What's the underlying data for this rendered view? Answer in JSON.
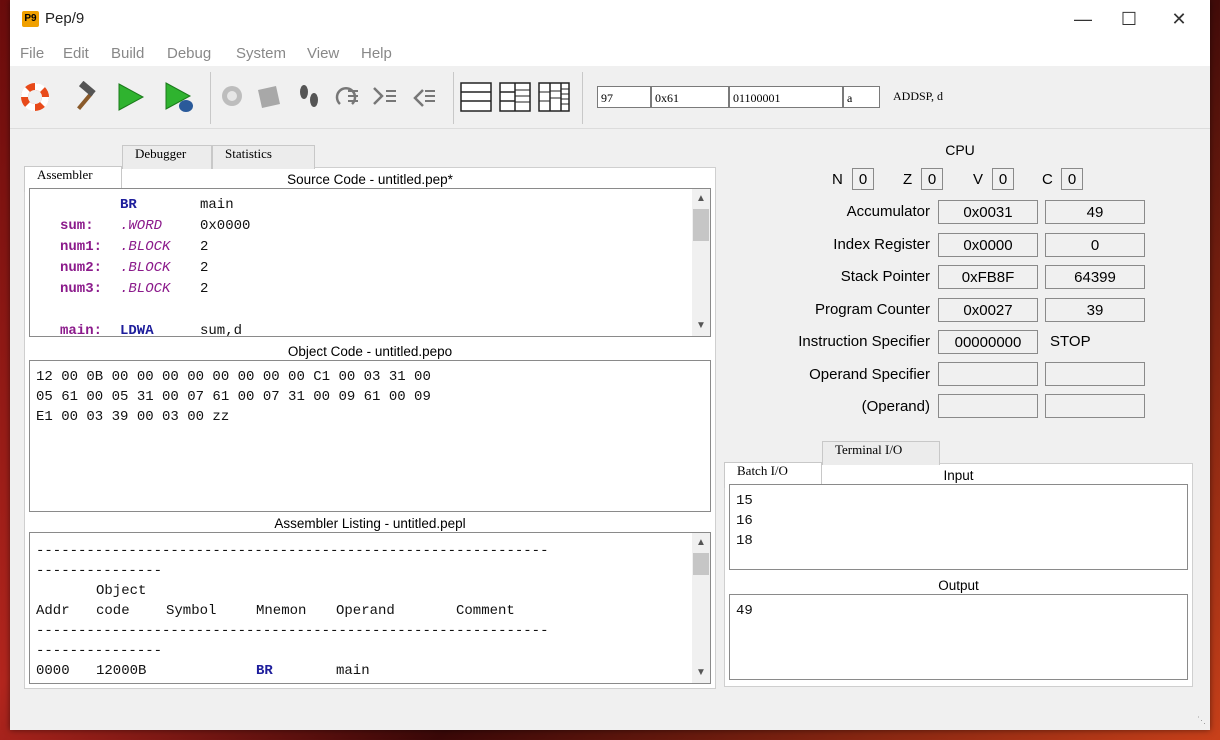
{
  "window": {
    "title": "Pep/9",
    "icon_text": "P9"
  },
  "menu": [
    "File",
    "Edit",
    "Build",
    "Debug",
    "System",
    "View",
    "Help"
  ],
  "toolbar": {
    "decimal": "97",
    "hex": "0x61",
    "binary": "01100001",
    "char": "a",
    "instruction": "ADDSP, d"
  },
  "left_tabs": [
    "Assembler",
    "Debugger",
    "Statistics"
  ],
  "source": {
    "title": "Source Code - untitled.pep*",
    "lines": [
      {
        "sym": "",
        "mn": "BR",
        "dir": "",
        "op": "main"
      },
      {
        "sym": "sum:",
        "mn": "",
        "dir": ".WORD",
        "op": "0x0000"
      },
      {
        "sym": "num1:",
        "mn": "",
        "dir": ".BLOCK",
        "op": "2"
      },
      {
        "sym": "num2:",
        "mn": "",
        "dir": ".BLOCK",
        "op": "2"
      },
      {
        "sym": "num3:",
        "mn": "",
        "dir": ".BLOCK",
        "op": "2"
      },
      {
        "sym": "",
        "mn": "",
        "dir": "",
        "op": ""
      },
      {
        "sym": "main:",
        "mn": "LDWA",
        "dir": "",
        "op": "sum,d"
      }
    ]
  },
  "object": {
    "title": "Object Code - untitled.pepo",
    "lines": [
      "12 00 0B 00 00 00 00 00 00 00 00 C1 00 03 31 00",
      "05 61 00 05 31 00 07 61 00 07 31 00 09 61 00 09",
      "E1 00 03 39 00 03 00 zz"
    ]
  },
  "listing": {
    "title": "Assembler Listing - untitled.pepl",
    "dash_long": "-------------------------------------------------------------",
    "dash_short": "---------------",
    "header_top": "Object",
    "headers": [
      "Addr",
      "code",
      "Symbol",
      "Mnemon",
      "Operand",
      "Comment"
    ],
    "row": {
      "addr": "0000",
      "code": "12000B",
      "symbol": "",
      "mnemon": "BR",
      "operand": "main"
    }
  },
  "cpu": {
    "title": "CPU",
    "flags": [
      {
        "name": "N",
        "value": "0"
      },
      {
        "name": "Z",
        "value": "0"
      },
      {
        "name": "V",
        "value": "0"
      },
      {
        "name": "C",
        "value": "0"
      }
    ],
    "registers": [
      {
        "label": "Accumulator",
        "hex": "0x0031",
        "dec": "49"
      },
      {
        "label": "Index Register",
        "hex": "0x0000",
        "dec": "0"
      },
      {
        "label": "Stack Pointer",
        "hex": "0xFB8F",
        "dec": "64399"
      },
      {
        "label": "Program Counter",
        "hex": "0x0027",
        "dec": "39"
      }
    ],
    "instr_spec": {
      "label": "Instruction Specifier",
      "bin": "00000000",
      "mnemonic": "STOP"
    },
    "operand_spec": {
      "label": "Operand Specifier",
      "hex": "",
      "dec": ""
    },
    "operand": {
      "label": "(Operand)",
      "hex": "",
      "dec": ""
    }
  },
  "io_tabs": [
    "Batch I/O",
    "Terminal I/O"
  ],
  "io": {
    "input_label": "Input",
    "input_lines": [
      "15",
      "16",
      "18"
    ],
    "output_label": "Output",
    "output_lines": [
      "49"
    ]
  }
}
